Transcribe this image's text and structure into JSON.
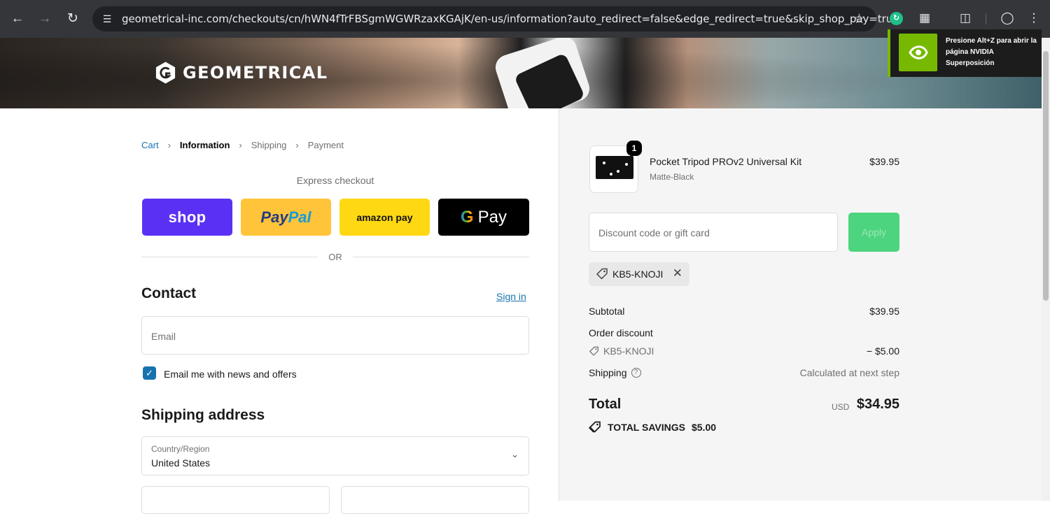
{
  "browser": {
    "url": "geometrical-inc.com/checkouts/cn/hWN4fTrFBSgmWGWRzaxKGAjK/en-us/information?auto_redirect=false&edge_redirect=true&skip_shop_pay=true"
  },
  "overlay": {
    "nvidia_message": "Presione Alt+Z para abrir la página NVIDIA Superposición"
  },
  "brand": {
    "name": "GEOMETRICAL"
  },
  "breadcrumb": {
    "cart": "Cart",
    "information": "Information",
    "shipping": "Shipping",
    "payment": "Payment"
  },
  "express": {
    "heading": "Express checkout",
    "shop_label": "shop",
    "paypal_part1": "Pay",
    "paypal_part2": "Pal",
    "amazon_label": "amazon pay",
    "gpay_label": "Pay",
    "or_label": "OR"
  },
  "contact": {
    "heading": "Contact",
    "signin": "Sign in",
    "email_placeholder": "Email",
    "news_checkbox_label": "Email me with news and offers",
    "news_checked": true
  },
  "shipping_address": {
    "heading": "Shipping address",
    "country_label": "Country/Region",
    "country_value": "United States"
  },
  "order": {
    "item": {
      "quantity": "1",
      "name": "Pocket Tripod PROv2 Universal Kit",
      "variant": "Matte-Black",
      "price": "$39.95"
    },
    "discount_placeholder": "Discount code or gift card",
    "apply_label": "Apply",
    "applied_code": "KB5-KNOJI",
    "subtotal_label": "Subtotal",
    "subtotal_value": "$39.95",
    "order_discount_label": "Order discount",
    "discount_code": "KB5-KNOJI",
    "discount_value": "− $5.00",
    "shipping_label": "Shipping",
    "shipping_value": "Calculated at next step",
    "total_label": "Total",
    "currency": "USD",
    "total_value": "$34.95",
    "savings_label": "TOTAL SAVINGS",
    "savings_value": "$5.00"
  },
  "colors": {
    "accent": "#1773b0",
    "shop_pay": "#5a31f4",
    "paypal": "#ffc439",
    "amazon": "#ffd814",
    "apply_button": "#4cd47e",
    "nvidia_green": "#76b900"
  }
}
